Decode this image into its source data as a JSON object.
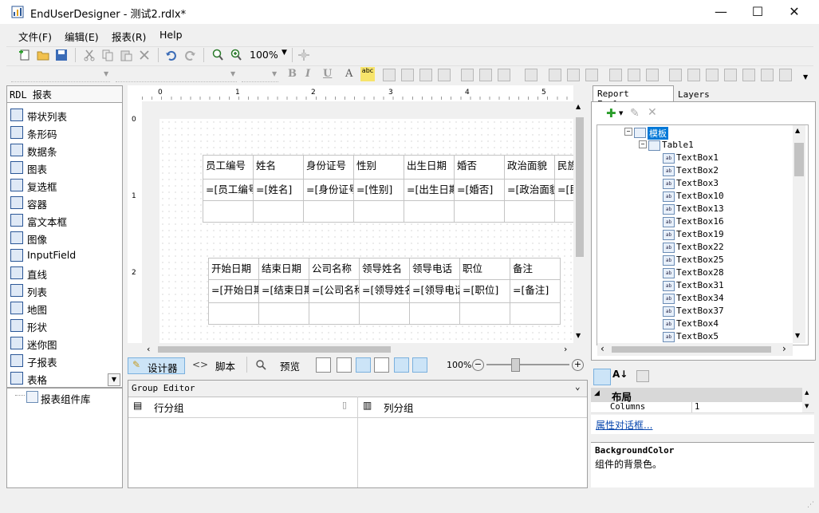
{
  "window": {
    "title": "EndUserDesigner - 测试2.rdlx*",
    "minimize": "—",
    "maximize": "☐",
    "close": "✕"
  },
  "menu": [
    "文件(F)",
    "编辑(E)",
    "报表(R)",
    "Help"
  ],
  "toolbar": {
    "zoom": "100%"
  },
  "toolbox": {
    "title": "RDL 报表",
    "items": [
      {
        "label": "带状列表",
        "icon": "banded-list-icon"
      },
      {
        "label": "条形码",
        "icon": "barcode-icon"
      },
      {
        "label": "数据条",
        "icon": "databar-icon"
      },
      {
        "label": "图表",
        "icon": "chart-icon"
      },
      {
        "label": "复选框",
        "icon": "checkbox-icon"
      },
      {
        "label": "容器",
        "icon": "container-icon"
      },
      {
        "label": "富文本框",
        "icon": "richtext-icon"
      },
      {
        "label": "图像",
        "icon": "image-icon"
      },
      {
        "label": "InputField",
        "icon": "inputfield-icon"
      },
      {
        "label": "直线",
        "icon": "line-icon"
      },
      {
        "label": "列表",
        "icon": "list-icon"
      },
      {
        "label": "地图",
        "icon": "map-icon"
      },
      {
        "label": "形状",
        "icon": "shape-icon"
      },
      {
        "label": "迷你图",
        "icon": "sparkline-icon"
      },
      {
        "label": "子报表",
        "icon": "subreport-icon"
      },
      {
        "label": "表格",
        "icon": "table-icon"
      }
    ]
  },
  "ruler": {
    "h": [
      "0",
      "1",
      "2",
      "3",
      "4",
      "5"
    ],
    "v": [
      "0",
      "1",
      "2"
    ]
  },
  "table1": {
    "headers": [
      "员工编号",
      "姓名",
      "身份证号",
      "性别",
      "出生日期",
      "婚否",
      "政治面貌",
      "民族"
    ],
    "details": [
      "=[员工编号]",
      "=[姓名]",
      "=[身份证号]",
      "=[性别]",
      "=[出生日期]",
      "=[婚否]",
      "=[政治面貌]",
      "=[民族]"
    ]
  },
  "table2": {
    "headers": [
      "开始日期",
      "结束日期",
      "公司名称",
      "领导姓名",
      "领导电话",
      "职位",
      "备注"
    ],
    "details": [
      "=[开始日期]",
      "=[结束日期]",
      "=[公司名称]",
      "=[领导姓名]",
      "=[领导电话]",
      "=[职位]",
      "=[备注]"
    ]
  },
  "viewtabs": {
    "designer": "设计器",
    "script": "脚本",
    "preview": "预览",
    "zoom": "100%"
  },
  "group_editor": {
    "title": "Group Editor",
    "row_groups": "行分组",
    "column_groups": "列分组"
  },
  "library": {
    "item": "报表组件库"
  },
  "explorer": {
    "tabs": [
      "Report Explorer",
      "Layers"
    ],
    "tree": [
      {
        "label": "模板",
        "level": 0,
        "selected": true
      },
      {
        "label": "Table1",
        "level": 1
      },
      {
        "label": "TextBox1",
        "level": 2
      },
      {
        "label": "TextBox2",
        "level": 2
      },
      {
        "label": "TextBox3",
        "level": 2
      },
      {
        "label": "TextBox10",
        "level": 2
      },
      {
        "label": "TextBox13",
        "level": 2
      },
      {
        "label": "TextBox16",
        "level": 2
      },
      {
        "label": "TextBox19",
        "level": 2
      },
      {
        "label": "TextBox22",
        "level": 2
      },
      {
        "label": "TextBox25",
        "level": 2
      },
      {
        "label": "TextBox28",
        "level": 2
      },
      {
        "label": "TextBox31",
        "level": 2
      },
      {
        "label": "TextBox34",
        "level": 2
      },
      {
        "label": "TextBox37",
        "level": 2
      },
      {
        "label": "TextBox4",
        "level": 2
      },
      {
        "label": "TextBox5",
        "level": 2
      }
    ]
  },
  "properties": {
    "category": "布局",
    "rows": [
      {
        "name": "Columns",
        "value": "1"
      }
    ],
    "dialog_link": "属性对话框...",
    "desc_title": "BackgroundColor",
    "desc_text": "组件的背景色。"
  },
  "colors": {
    "selection": "#0078d7",
    "tab_active": "#cce4f7"
  }
}
